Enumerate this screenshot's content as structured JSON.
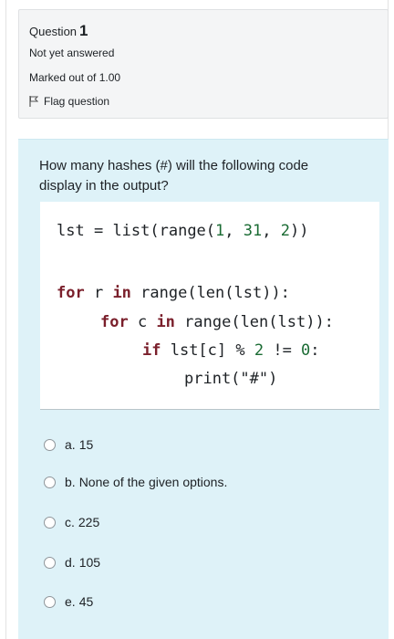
{
  "info": {
    "question_label": "Question",
    "question_number": "1",
    "state": "Not yet answered",
    "grade": "Marked out of 1.00",
    "flag_label": "Flag question"
  },
  "question": {
    "text": "How many hashes (#) will the following code display in the output?"
  },
  "code": {
    "line1": {
      "var": "lst",
      "eq": " = ",
      "call": "list(range(",
      "a": "1",
      "sep1": ", ",
      "b": "31",
      "sep2": ", ",
      "c": "2",
      "close": "))"
    },
    "line2": {
      "kw1": "for",
      "mid1": " r ",
      "kw2": "in",
      "rest": " range(len(lst)):"
    },
    "line3": {
      "kw1": "for",
      "mid1": " c ",
      "kw2": "in",
      "rest": " range(len(lst)):"
    },
    "line4": {
      "kw1": "if",
      "mid": " lst[c] % ",
      "n1": "2",
      "op": " != ",
      "n2": "0",
      "end": ":"
    },
    "line5": {
      "text": "print(\"#\")"
    }
  },
  "options": [
    {
      "letter": "a.",
      "text": "15"
    },
    {
      "letter": "b.",
      "text": "None of the given options."
    },
    {
      "letter": "c.",
      "text": "225"
    },
    {
      "letter": "d.",
      "text": "105"
    },
    {
      "letter": "e.",
      "text": "45"
    }
  ]
}
